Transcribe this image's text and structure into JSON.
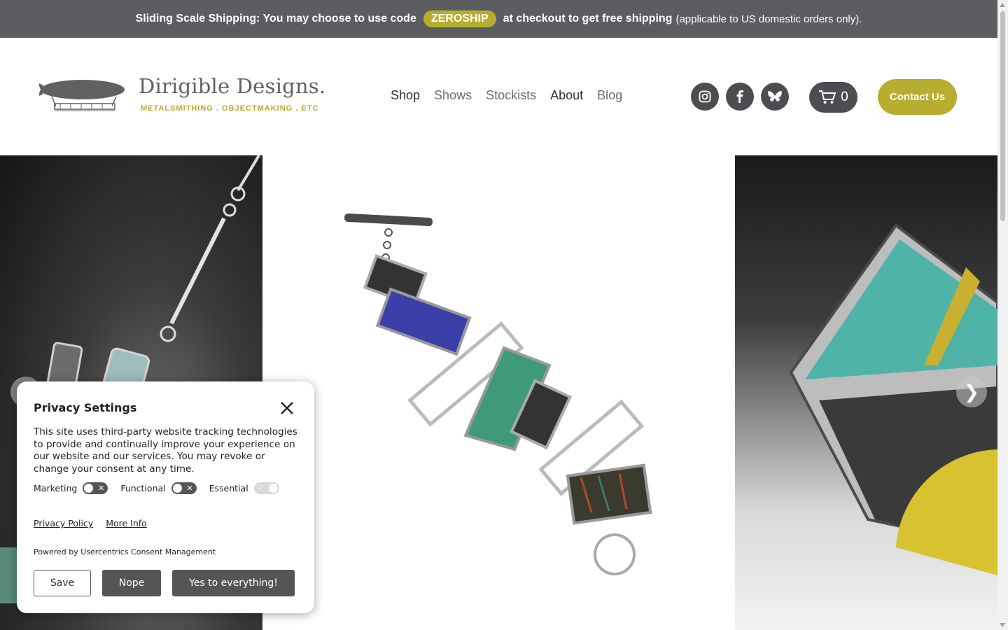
{
  "announcement": {
    "bold_prefix": "Sliding Scale Shipping: You may choose to use code",
    "code": "ZEROSHIP",
    "bold_suffix": "at checkout to get free shipping",
    "note": "(applicable to US domestic orders only)."
  },
  "logo": {
    "name": "Dirigible Designs.",
    "tagline": "METALSMITHING . OBJECTMAKING . ETC"
  },
  "nav": {
    "items": [
      {
        "label": "Shop"
      },
      {
        "label": "Shows"
      },
      {
        "label": "Stockists"
      },
      {
        "label": "About"
      },
      {
        "label": "Blog"
      }
    ]
  },
  "social": {
    "icons": [
      "instagram-icon",
      "facebook-icon",
      "bluesky-icon"
    ]
  },
  "cart": {
    "count": "0",
    "icon": "cart-icon"
  },
  "contact": {
    "label": "Contact Us"
  },
  "colors": {
    "announcement_bg": "#5b5d60",
    "accent": "#b7ad2f",
    "dark_button": "#4b4d50"
  },
  "gallery": {
    "prev_glyph": "❮",
    "next_glyph": "❯"
  },
  "privacy": {
    "title": "Privacy Settings",
    "text": "This site uses third-party website tracking technologies to provide and continually improve your experience on our website and our services. You may revoke or change your consent at any time.",
    "toggles": [
      {
        "label": "Marketing",
        "state": "off"
      },
      {
        "label": "Functional",
        "state": "off"
      },
      {
        "label": "Essential",
        "state": "on-disabled"
      }
    ],
    "links": {
      "policy": "Privacy Policy",
      "more": "More Info"
    },
    "powered_by": "Powered by Usercentrics Consent Management",
    "buttons": {
      "save": "Save",
      "nope": "Nope",
      "yes": "Yes to everything!"
    }
  }
}
